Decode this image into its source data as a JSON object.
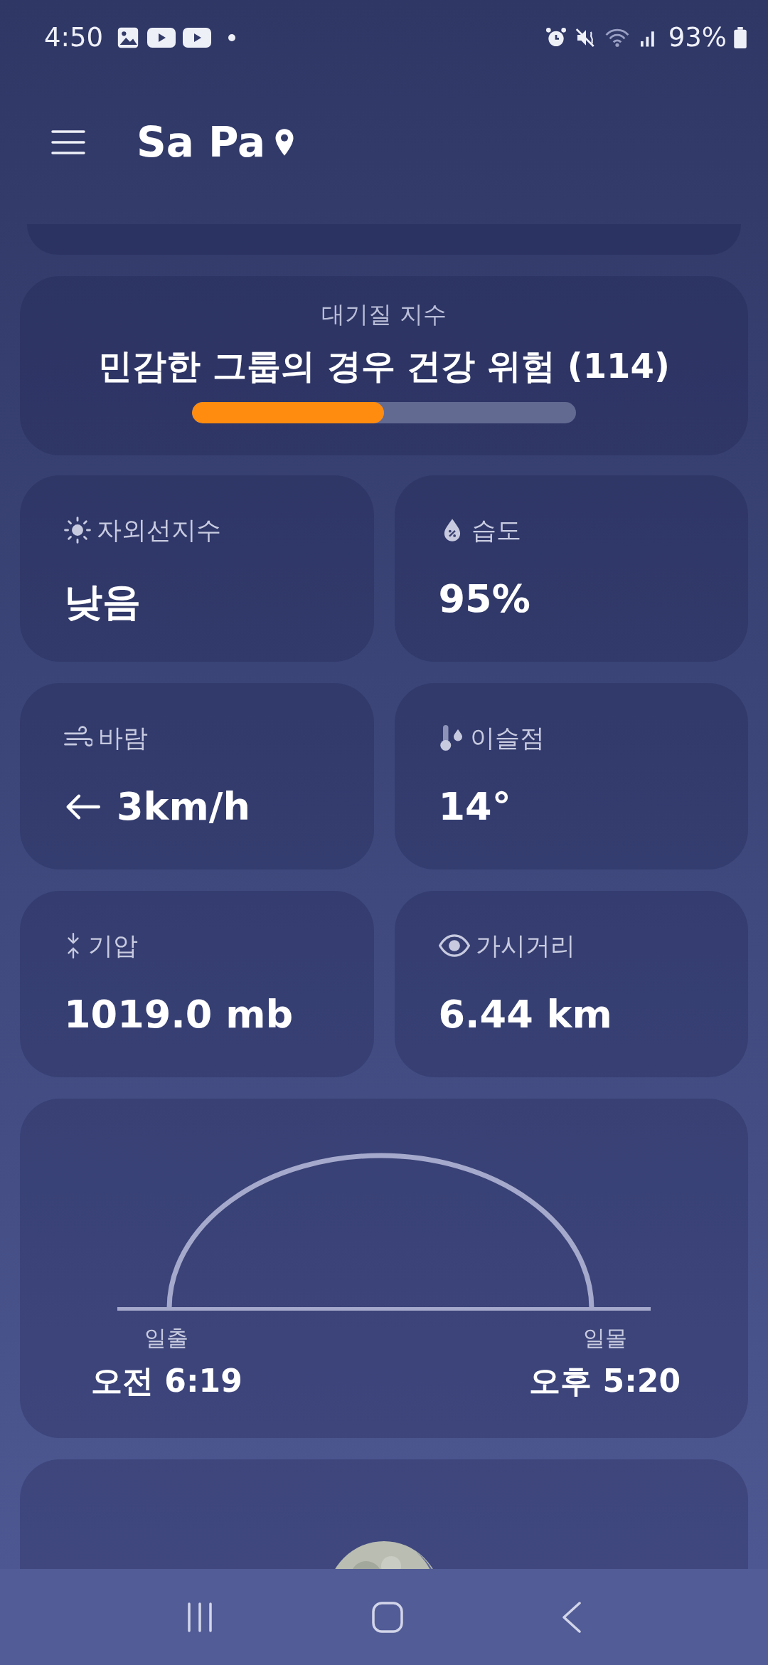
{
  "status_bar": {
    "time": "4:50",
    "battery": "93%"
  },
  "header": {
    "title": "Sa Pa"
  },
  "air_quality": {
    "label": "대기질 지수",
    "value": "민감한 그룹의 경우 건강 위험 (114)",
    "level": 0.5
  },
  "tiles": [
    {
      "kind": "uv",
      "label": "자외선지수",
      "value": "낮음"
    },
    {
      "kind": "humidity",
      "label": "습도",
      "value": "95%"
    },
    {
      "kind": "wind",
      "label": "바람",
      "value": "3km/h"
    },
    {
      "kind": "dew_point",
      "label": "이슬점",
      "value": "14°"
    },
    {
      "kind": "pressure",
      "label": "기압",
      "value": "1019.0 mb"
    },
    {
      "kind": "visibility",
      "label": "가시거리",
      "value": "6.44 km"
    }
  ],
  "sun": {
    "sunrise_label": "일출",
    "sunrise_time": "오전 6:19",
    "sunset_label": "일몰",
    "sunset_time": "오후 5:20"
  }
}
